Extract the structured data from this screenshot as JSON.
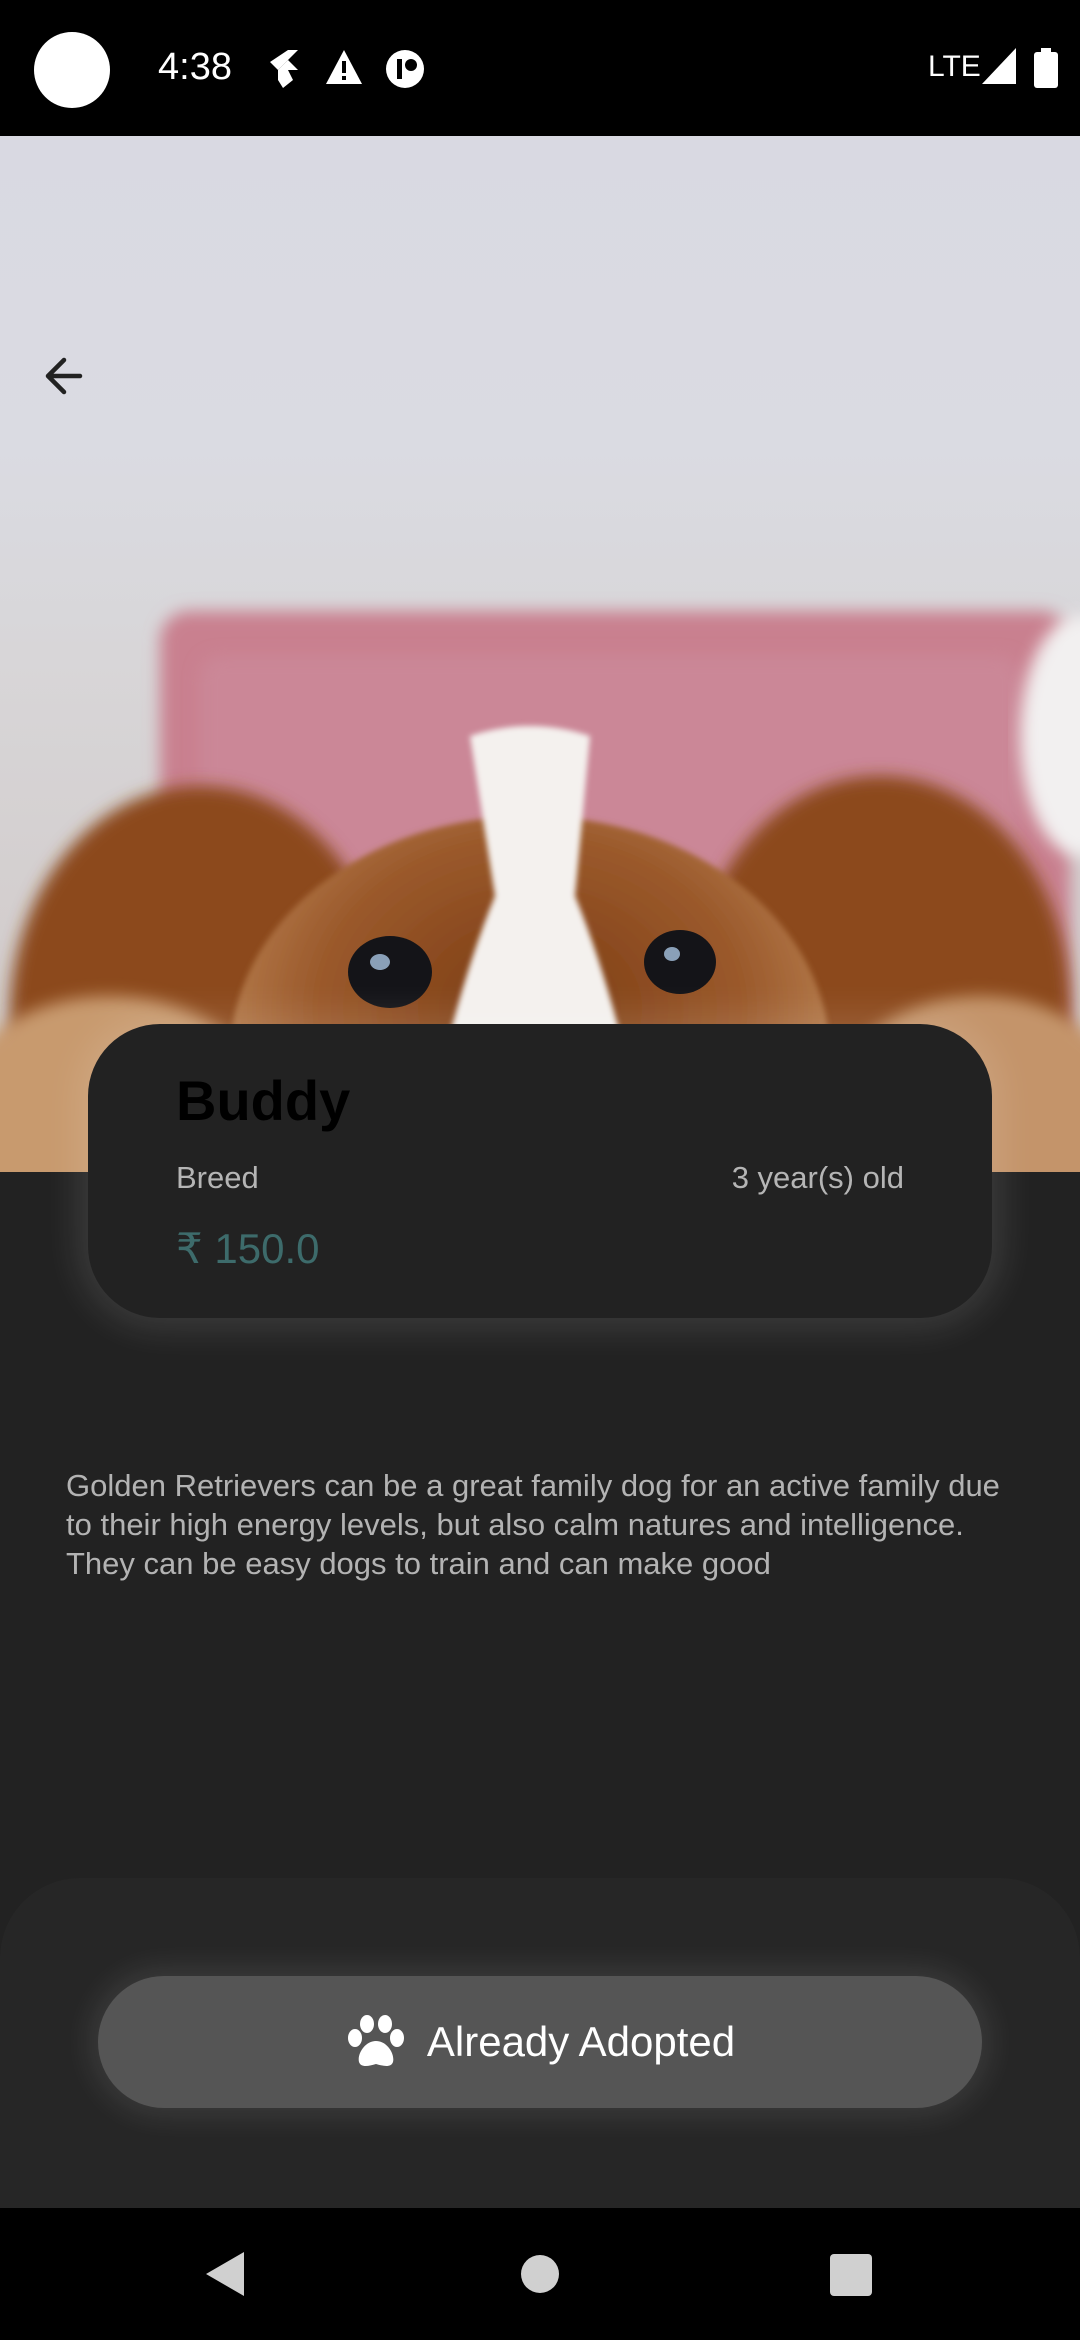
{
  "status_bar": {
    "time": "4:38",
    "network": "LTE"
  },
  "pet": {
    "name": "Buddy",
    "breed": "Breed",
    "age": "3 year(s) old",
    "price": "₹ 150.0",
    "description": "Golden Retrievers can be a great family dog for an active family due to their high energy levels, but also calm natures and intelligence. They can be easy dogs to train and can make good"
  },
  "actions": {
    "adopt_label": "Already Adopted"
  },
  "icons": {
    "back": "arrow-back-icon",
    "paw": "paw-icon",
    "nav": [
      "nav-back-icon",
      "nav-home-icon",
      "nav-recents-icon"
    ]
  },
  "colors": {
    "background": "#222222",
    "price": "#3d6b6b",
    "button": "#555555"
  }
}
